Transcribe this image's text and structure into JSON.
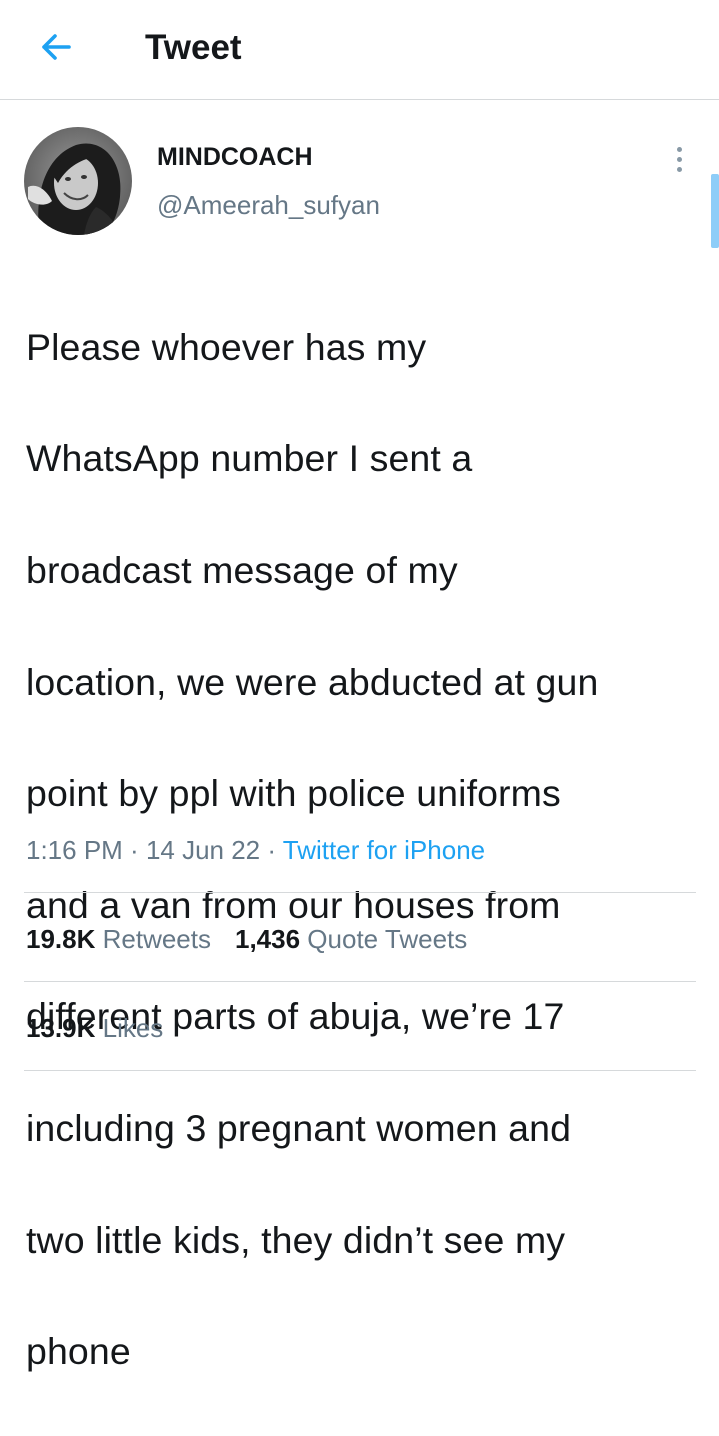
{
  "header": {
    "title": "Tweet",
    "back_icon": "arrow-left-icon",
    "accent_color": "#1da1f2"
  },
  "author": {
    "display_name": "MINDCOACH",
    "handle": "@Ameerah_sufyan",
    "avatar_icon": "avatar"
  },
  "tweet": {
    "text_lines": [
      "Please whoever has my",
      "WhatsApp number I sent a",
      "broadcast message of my",
      "location, we were abducted at gun",
      "point by ppl with police uniforms",
      "and a van from our houses from",
      "different parts of abuja, we’re 17",
      "including 3 pregnant women and",
      "two little kids, they didn’t see my",
      "phone"
    ],
    "time": "1:16 PM",
    "separator": " · ",
    "date": "14 Jun 22",
    "source": "Twitter for iPhone"
  },
  "stats": {
    "retweets_count": "19.8K",
    "retweets_label": " Retweets",
    "quotes_count": "1,436",
    "quotes_label": " Quote Tweets",
    "likes_count": "13.9K",
    "likes_label": " Likes"
  },
  "colors": {
    "text_primary": "#14171a",
    "text_secondary": "#657786",
    "link": "#1da1f2",
    "divider": "#d6d9db"
  }
}
